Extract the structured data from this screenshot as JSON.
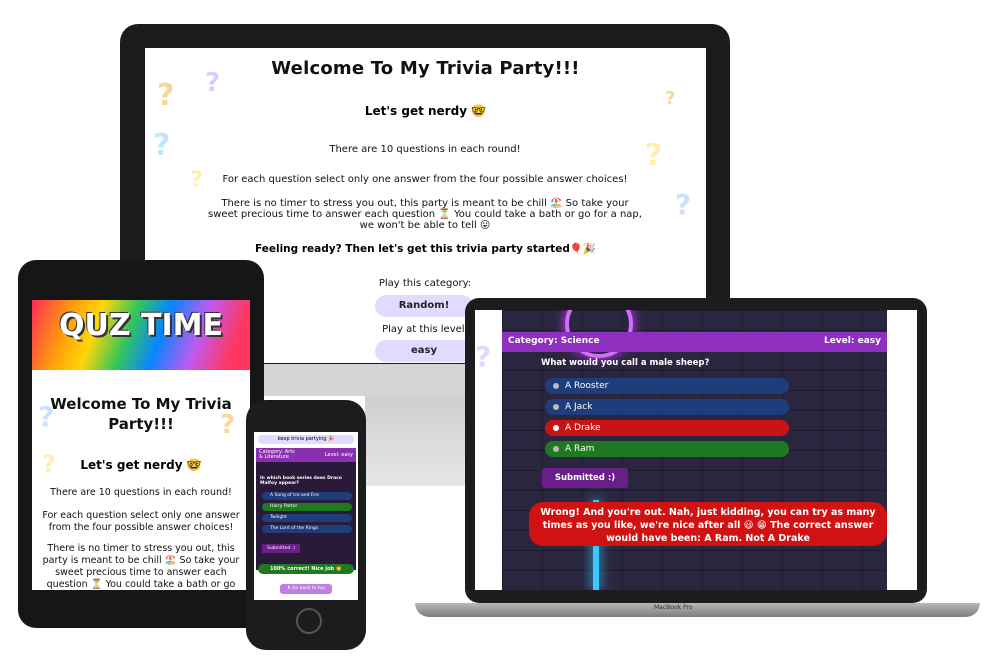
{
  "desktop": {
    "title": "Welcome To My Trivia Party!!!",
    "subtitle": "Let's get nerdy 🤓",
    "p1": "There are 10 questions in each round!",
    "p2": "For each question select only one answer from the four possible answer choices!",
    "p3": "There is no timer to stress you out, this party is meant to be chill 🏖️ So take your sweet precious time to answer each question ⏳ You could take a bath or go for a nap, we won't be able to tell 😛",
    "p4": "Feeling ready? Then let's get this trivia party started🎈🎉",
    "category_label": "Play this category:",
    "category_value": "Random!",
    "level_label": "Play at this level:",
    "level_value": "easy"
  },
  "tablet": {
    "banner": "QUZ TIME",
    "title": "Welcome To My Trivia Party!!!",
    "subtitle": "Let's get nerdy 🤓",
    "p1": "There are 10 questions in each round!",
    "p2": "For each question select only one answer from the four possible answer choices!",
    "p3": "There is no timer to stress you out, this party is meant to be chill 🏖️ So take your sweet precious time to answer each question ⏳ You could take a bath or go for"
  },
  "phone": {
    "header": "keep trivia partying 🎉",
    "category": "Category: Arts & Literature",
    "level": "Level: easy",
    "question": "In which book series does Draco Malfoy appear?",
    "answers": [
      "A Song of Ice and Fire",
      "Harry Potter",
      "Twilight",
      "The Lord of the Rings"
    ],
    "submitted": "Submitted :)",
    "correct": "100% correct! Nice job 👏",
    "back_button": "⬆ Go back to top"
  },
  "laptop": {
    "category": "Category: Science",
    "level": "Level: easy",
    "question": "What would you call a male sheep?",
    "answers": [
      {
        "label": "A Rooster",
        "state": "default"
      },
      {
        "label": "A Jack",
        "state": "default"
      },
      {
        "label": "A Drake",
        "state": "wrong"
      },
      {
        "label": "A Ram",
        "state": "correct"
      }
    ],
    "submitted": "Submitted :)",
    "message": "Wrong! And you're out. Nah, just kidding, you can try as many times as you like, we're nice after all 😃 😁 The correct answer would have been: A Ram. Not A Drake",
    "brand": "MacBook Pro"
  },
  "colors": {
    "accent_purple": "#8e2fc0",
    "pill_lavender": "#e3dbff",
    "answer_blue": "#1f3d7a",
    "wrong_red": "#c81414",
    "correct_green": "#1f7a1f"
  },
  "icons": [
    "apple-logo-icon",
    "question-mark-decoration-icon",
    "radio-dot-icon"
  ]
}
